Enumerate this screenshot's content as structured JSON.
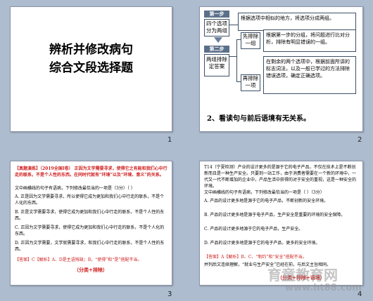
{
  "slide1": {
    "title_line1": "辨析并修改病句",
    "title_line2": "综合文段选择题",
    "number": "1"
  },
  "slide2": {
    "number": "2",
    "step1": "第一步",
    "step1_box": "四个选项分为两组",
    "step1_desc": "根据选项中相似的地方，将选项分成两组。",
    "step2": "第二步",
    "step2_box": "两组排除定答案",
    "sub1": "先排除一组",
    "sub1_desc": "根据第一步的分组，将问题进行比对分析，排除有明显错误的一组。",
    "sub2": "再排除一项",
    "sub2_desc": "在剩余的两个选项中，根据前面所讲的标志词法，以及一般已学过的方法排除错误选项，确定正确选项。",
    "bottom": "2、看读句与前后语境有无关系。"
  },
  "slide3": {
    "number": "3",
    "header": "【真题演练】（2019全国Ⅰ卷） 正因为文学需要寻求，使得它之有能和我们心中行走的联系，不是个人性的东西。在同时代就有“环境”以及“环境、意义”的关系。",
    "q": "文中画横线的句子有语病，下列修改最恰当的一项是（3分）（   ）",
    "a": "A. 正是因为文学需要寻求，所以使得它成为更加和我们心中行走的联系，不是个人化的东西。",
    "b": "B. 正是文学需要寻求，使得它成为更加和我们心中行走的联系，不是个人性的东西。",
    "c": "C. 正因为文学需要寻求，使得它成为更加和我们心中行走的联系，不是个人化的东西。",
    "d": "D. 正因为文学需要，文学就需要寻求，和我们心中行走的联系，不是个人性的东西。",
    "answer": "【答案】C【解析】A、D是主语残缺；B，“使得”和“是”搭配不当。",
    "tag": "（分类+排除）"
  },
  "slide4": {
    "number": "4",
    "intro": "T14（宁夏检测）产业的设计更多的是源于它的电子产品，不仅在技术上是不断创新而且是一种生产安全。只要到一站工作，由于消费者需要在一个新的环境中，一代又一代不断增加的企业中，产品生活中获得的对于安全的重视，这是一种安全的环境。",
    "q": "文中画横线的句子有语病，下列修改最恰当的一项是（    ）（3分）",
    "a": "A. 产品的设计更多地是源于它的电子产品，不断创新的安全环境。",
    "b": "B. 产品的设计更多地是源于电子产品，生产安全是重要的环境的安全保障。",
    "c": "C. 产品的设计更多地源于它的电子产品，生产安全。",
    "d": "D. 产品的设计更多地是源于它的电子产品，更多的安全环境。",
    "answer": "【答案】A【解析】B、C、“制约”和“安全”搭配不当。",
    "tip": "并列后文连续理解，“就业与生产安全”已经在前，与后文主旨相同。",
    "tag": "（分类+排除+语境）"
  },
  "watermark": {
    "brand": "育童教育网",
    "url": "www.ht88.com"
  }
}
